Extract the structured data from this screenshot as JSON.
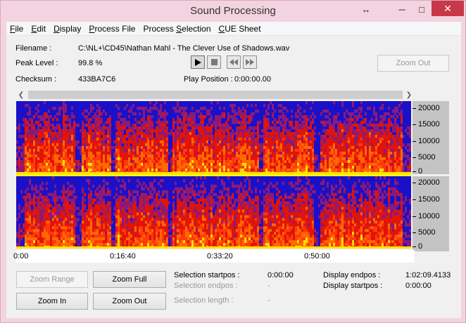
{
  "window": {
    "title": "Sound Processing"
  },
  "titlebar": {
    "resize_glyph": "↔",
    "min_glyph": "─",
    "max_glyph": "□",
    "close_glyph": "✕"
  },
  "menu": {
    "file": {
      "u": "F",
      "rest": "ile"
    },
    "edit": {
      "u": "E",
      "rest": "dit"
    },
    "display": {
      "u": "D",
      "rest": "isplay"
    },
    "process_file": {
      "u": "P",
      "rest": "rocess File"
    },
    "process_selection": {
      "pre": "Process ",
      "u": "S",
      "rest": "election"
    },
    "cue_sheet": {
      "u": "C",
      "rest": "UE Sheet"
    }
  },
  "info": {
    "filename_label": "Filename :",
    "filename_value": "C:\\NL+\\CD45\\Nathan Mahl - The Clever Use of Shadows.wav",
    "peak_label": "Peak Level :",
    "peak_value": "99.8 %",
    "checksum_label": "Checksum :",
    "checksum_value": "433BA7C6",
    "play_position_label": "Play Position :",
    "play_position_value": "0:00:00.00"
  },
  "player": {
    "play_icon": "play-icon",
    "stop_icon": "stop-icon",
    "rewind_icon": "rewind-icon",
    "forward_icon": "fast-forward-icon"
  },
  "zoom_out_top": "Zoom Out",
  "spectrogram": {
    "y_ticks": [
      "20000",
      "15000",
      "10000",
      "5000",
      "0"
    ],
    "time_labels": [
      "0:00",
      "0:16:40",
      "0:33:20",
      "0:50:00"
    ]
  },
  "buttons": {
    "zoom_range": "Zoom Range",
    "zoom_full": "Zoom Full",
    "zoom_in": "Zoom In",
    "zoom_out": "Zoom Out"
  },
  "selection": {
    "startpos_label": "Selection startpos :",
    "startpos_value": "0:00:00",
    "endpos_label": "Selection endpos :",
    "endpos_value": "-",
    "length_label": "Selection length :",
    "length_value": "-"
  },
  "display_range": {
    "endpos_label": "Display endpos :",
    "endpos_value": "1:02:09.4133",
    "startpos_label": "Display startpos :",
    "startpos_value": "0:00:00"
  },
  "colors": {
    "spectrum_low": "#1a10c8",
    "spectrum_mid": "#e0140a",
    "spectrum_high": "#ffe200",
    "title_bg": "#f3d3df",
    "close_bg": "#c7394a"
  }
}
